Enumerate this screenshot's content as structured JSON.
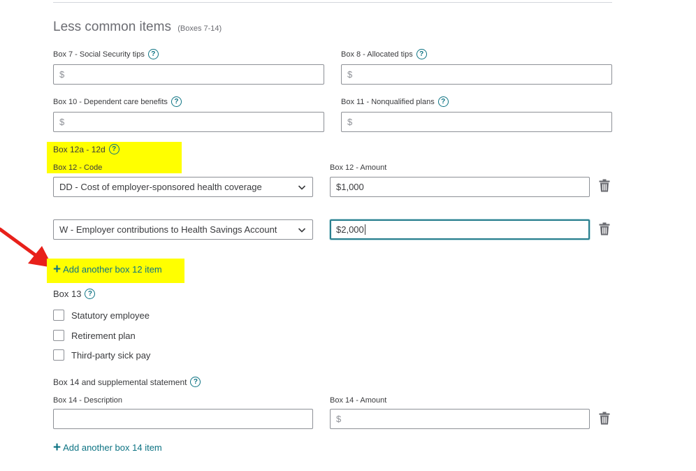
{
  "section": {
    "title": "Less common items",
    "subtitle": "(Boxes 7-14)"
  },
  "box7": {
    "label": "Box 7 - Social Security tips",
    "placeholder": "$"
  },
  "box8": {
    "label": "Box 8 - Allocated tips",
    "placeholder": "$"
  },
  "box10": {
    "label": "Box 10 - Dependent care benefits",
    "placeholder": "$"
  },
  "box11": {
    "label": "Box 11 - Nonqualified plans",
    "placeholder": "$"
  },
  "box12": {
    "heading": "Box 12a - 12d",
    "code_label": "Box 12 - Code",
    "amount_label": "Box 12 - Amount",
    "rows": [
      {
        "code": "DD - Cost of employer-sponsored health coverage",
        "amount": "$1,000"
      },
      {
        "code": "W - Employer contributions to Health Savings Account",
        "amount": "$2,000"
      }
    ],
    "add_label": "Add another box 12 item"
  },
  "box13": {
    "heading": "Box 13",
    "options": [
      "Statutory employee",
      "Retirement plan",
      "Third-party sick pay"
    ]
  },
  "box14": {
    "heading": "Box 14 and supplemental statement",
    "description_label": "Box 14 - Description",
    "amount_label": "Box 14 - Amount",
    "amount_placeholder": "$",
    "add_label": "Add another box 14 item"
  },
  "help_glyph": "?",
  "plus_glyph": "+",
  "colors": {
    "accent": "#0d7383",
    "highlight": "#ffff00",
    "arrow": "#e8201a",
    "border": "#8d9096"
  },
  "icons": {
    "help": "question-circle-icon",
    "delete": "trash-icon",
    "dropdown": "chevron-down-icon",
    "add": "plus-icon"
  }
}
